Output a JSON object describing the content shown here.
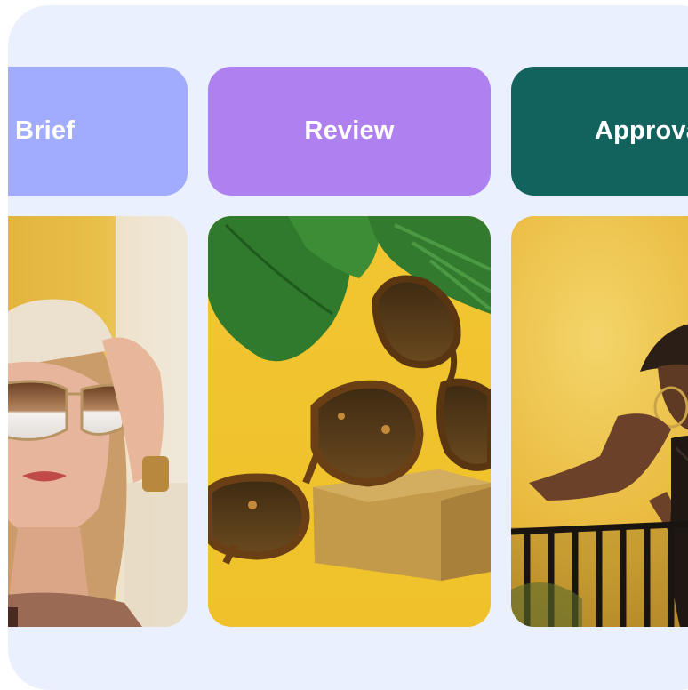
{
  "workflow": {
    "stages": [
      {
        "label": "Brief",
        "color": "#a2acff"
      },
      {
        "label": "Review",
        "color": "#ae80f0"
      },
      {
        "label": "Approval",
        "color": "#12625d"
      }
    ]
  },
  "panel": {
    "background": "#eaf0fd"
  },
  "images": [
    {
      "subject": "woman-in-mirrored-sunglasses-photo"
    },
    {
      "subject": "tortoiseshell-sunglasses-product-photo"
    },
    {
      "subject": "woman-in-hat-on-balcony-photo"
    }
  ]
}
